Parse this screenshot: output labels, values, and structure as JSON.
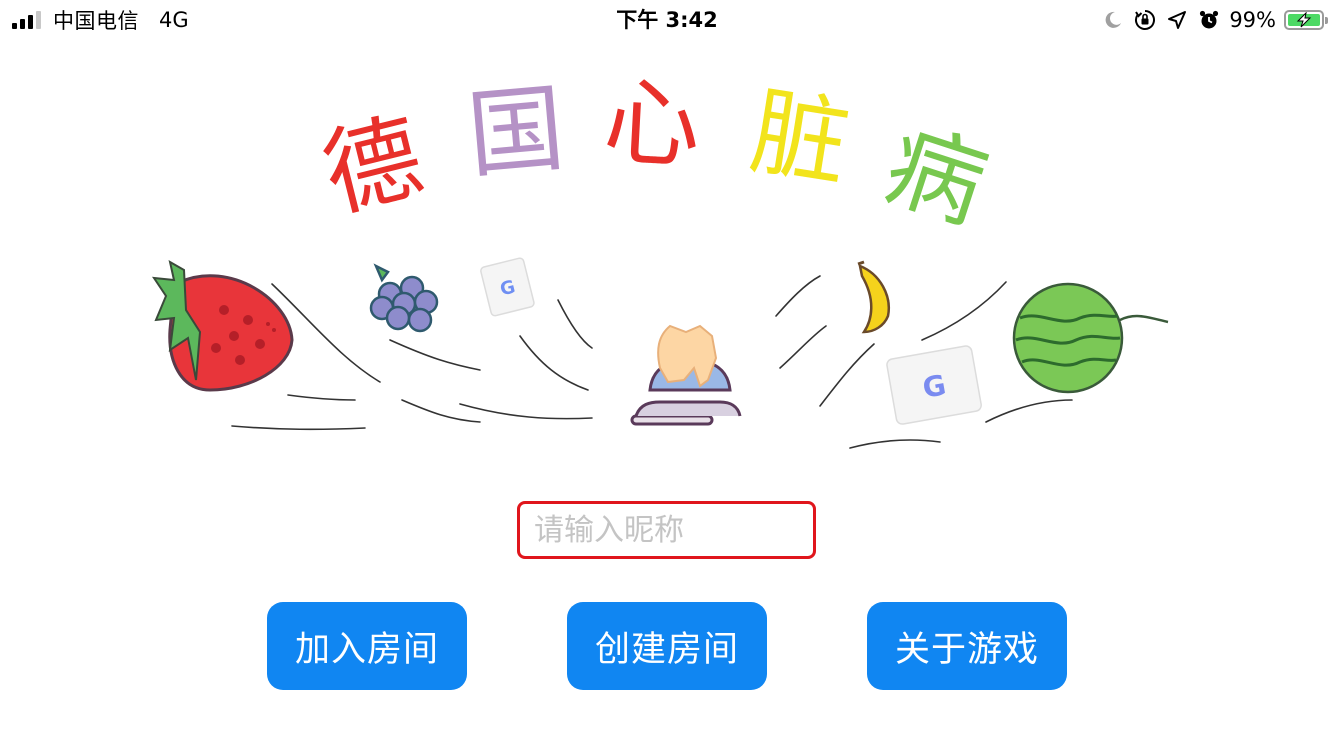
{
  "status_bar": {
    "carrier": "中国电信",
    "network": "4G",
    "time": "下午 3:42",
    "battery_percent": "99%",
    "icons": [
      "signal-icon",
      "moon-icon",
      "orientation-lock-icon",
      "location-arrow-icon",
      "alarm-icon",
      "battery-charging-icon"
    ]
  },
  "title": {
    "chars": [
      "德",
      "国",
      "心",
      "脏",
      "病"
    ],
    "colors": [
      "#e8302a",
      "#b592c6",
      "#e8302a",
      "#f2e41c",
      "#78c84f"
    ]
  },
  "illustration": {
    "items": [
      "strawberry-icon",
      "grapes-icon",
      "card-icon",
      "hand-bell-icon",
      "banana-icon",
      "card-icon",
      "watermelon-icon"
    ]
  },
  "nickname": {
    "placeholder": "请输入昵称",
    "value": ""
  },
  "buttons": {
    "join_room": "加入房间",
    "create_room": "创建房间",
    "about_game": "关于游戏"
  },
  "colors": {
    "button_bg": "#1086f2",
    "input_border": "#e0161c",
    "battery_green": "#4cd964"
  }
}
